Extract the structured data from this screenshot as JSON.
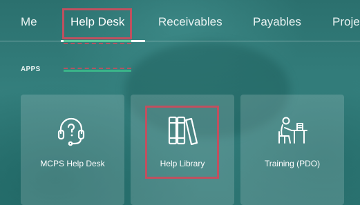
{
  "nav": {
    "tabs": [
      {
        "label": "Me"
      },
      {
        "label": "Help Desk",
        "selected": true
      },
      {
        "label": "Receivables"
      },
      {
        "label": "Payables"
      },
      {
        "label": "Projec"
      }
    ]
  },
  "section": {
    "label": "APPS"
  },
  "apps": [
    {
      "label": "MCPS Help Desk",
      "icon": "headset-question-icon"
    },
    {
      "label": "Help Library",
      "icon": "books-icon"
    },
    {
      "label": "Training (PDO)",
      "icon": "student-desk-icon"
    }
  ],
  "colors": {
    "background": "#2f7a78",
    "tile": "rgba(255,255,255,0.16)",
    "highlight": "#c0505f",
    "text": "#ffffff"
  }
}
